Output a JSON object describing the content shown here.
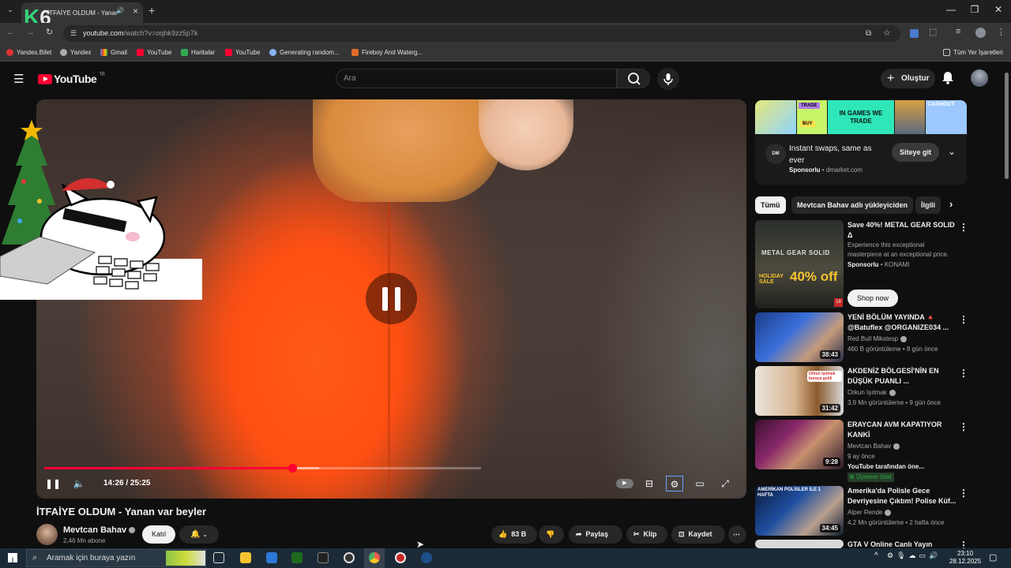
{
  "browser": {
    "tab_title": "İTFAİYE OLDUM - Yanan var",
    "url_host": "youtube.com",
    "url_path": "/watch?v=oqhk9zz5p7k",
    "bookmarks": [
      "Yandex.Bilet",
      "Yandex",
      "Gmail",
      "YouTube",
      "Haritalar",
      "YouTube",
      "Generating random...",
      "Fireboy And Waterg..."
    ],
    "all_bookmarks": "Tüm Yer İşaretleri"
  },
  "overlay_logo": {
    "letter": "K",
    "digit": "6"
  },
  "yt": {
    "logo_text": "YouTube",
    "logo_sup": "TR",
    "search_placeholder": "Ara",
    "create_label": "Oluştur"
  },
  "player": {
    "time": "14:26 / 25:25",
    "progress": 0.567,
    "buffered": 0.63
  },
  "video": {
    "title": "İTFAİYE OLDUM - Yanan var beyler",
    "channel": "Mevtcan Bahav",
    "subscribers": "2,46 Mn abone",
    "join_label": "Katıl",
    "likes": "83 B",
    "share_label": "Paylaş",
    "clip_label": "Klip",
    "save_label": "Kaydet"
  },
  "ad": {
    "tiles": [
      "TRADE",
      "BUY",
      "IN GAMES WE TRADE",
      "CASHOUT"
    ],
    "brand": "DM",
    "headline": "Instant swaps, same as ever",
    "sponsored": "Sponsorlu",
    "domain": "dmarket.com",
    "cta": "Siteye git"
  },
  "chips": [
    "Tümü",
    "Mevtcan Bahav adlı yükleyiciden",
    "İlgili"
  ],
  "sidebar_ad": {
    "title": "Save 40%! METAL GEAR SOLID Δ",
    "desc": "Experience this exceptional masterpiece at an exceptional price.",
    "sponsored": "Sponsorlu",
    "advertiser": "KONAMI",
    "cta": "Shop now",
    "thumb_text": "METAL GEAR SOLID",
    "sale_text": "40% off",
    "sale_label": "HOLIDAY SALE",
    "rating": "18"
  },
  "recommendations": [
    {
      "title": "YENİ BÖLÜM YAYINDA 🔺 @Batuflex @ORGANIZE034 ...",
      "channel": "Red Bull Mikstesp",
      "meta": "460 B görüntüleme • 8 gün önce",
      "duration": "38:43"
    },
    {
      "title": "AKDENİZ BÖLGESİ'NİN EN DÜŞÜK PUANLI ...",
      "channel": "Orkun Işıtmak",
      "meta": "3,9 Mn görüntüleme • 9 gün önce",
      "duration": "31:42",
      "thumb_text": "Orkun Işıtmak buraya geldi"
    },
    {
      "title": "ERAYCAN AVM KAPATIYOR KANKİ",
      "channel": "Mevtcan Bahav",
      "meta": "9 ay önce",
      "extra": "YouTube tarafından öne...",
      "badge": "Üyelere özel",
      "duration": "9:28"
    },
    {
      "title": "Amerika'da Polisle Gece Devriyesine Çıktım! Polise Küf...",
      "channel": "Alper Rende",
      "meta": "4,2 Mn görüntüleme • 2 hafta önce",
      "duration": "34:45",
      "thumb_text": "AMERİKAN POLİSLER İLE 1 HAFTA"
    },
    {
      "title": "GTA V Online Canlı Yayın"
    }
  ],
  "taskbar": {
    "search_placeholder": "Aramak için buraya yazın",
    "time": "23:10",
    "date": "28.12.2025"
  },
  "colors": {
    "accent": "#ff0033",
    "background": "#0f0f0f",
    "chip": "#272727"
  }
}
